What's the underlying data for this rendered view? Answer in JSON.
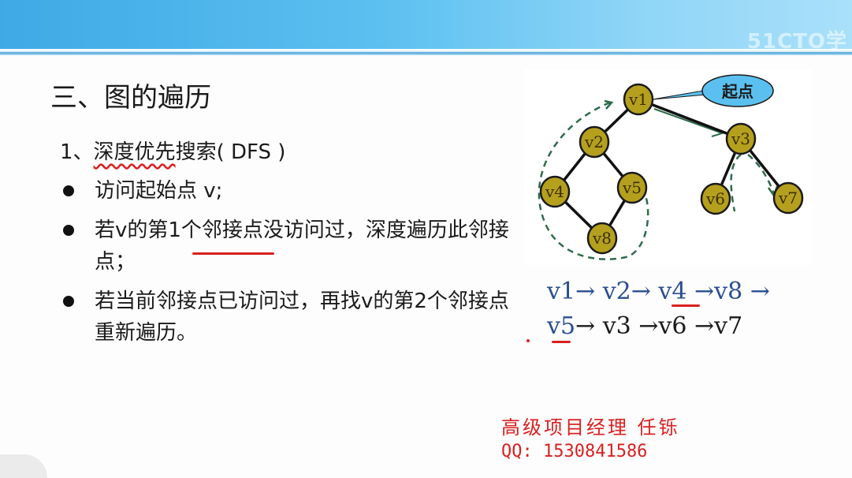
{
  "slide": {
    "title": "三、图的遍历",
    "watermark": "51CTO学",
    "section_prefix": "1、",
    "section_underlined": "深度优先",
    "section_rest": "搜索( DFS )",
    "bullets": [
      "访问起始点 v;",
      "若v的第1个邻接点没访问过，深度遍历此邻接点；",
      "若当前邻接点已访问过，再找v的第2个邻接点重新遍历。"
    ]
  },
  "graph": {
    "start_label": "起点",
    "nodes": [
      "v1",
      "v2",
      "v3",
      "v4",
      "v5",
      "v6",
      "v7",
      "v8"
    ],
    "edges": [
      [
        "v1",
        "v2"
      ],
      [
        "v1",
        "v3"
      ],
      [
        "v2",
        "v4"
      ],
      [
        "v2",
        "v5"
      ],
      [
        "v4",
        "v8"
      ],
      [
        "v5",
        "v8"
      ],
      [
        "v3",
        "v6"
      ],
      [
        "v3",
        "v7"
      ]
    ],
    "colors": {
      "node_fill": "#b5a01e",
      "node_stroke": "#1a1a1a",
      "dashed": "#2e6b4a",
      "callout": "#5bc0f0"
    }
  },
  "sequence": {
    "line1": "v1→ v2→ v4 →v8 →",
    "line2_first": "v5",
    "line2_rest": "→ v3 →v6 →v7"
  },
  "footer": {
    "author": "高级项目经理   任铄",
    "contact": "QQ: 1530841586"
  }
}
